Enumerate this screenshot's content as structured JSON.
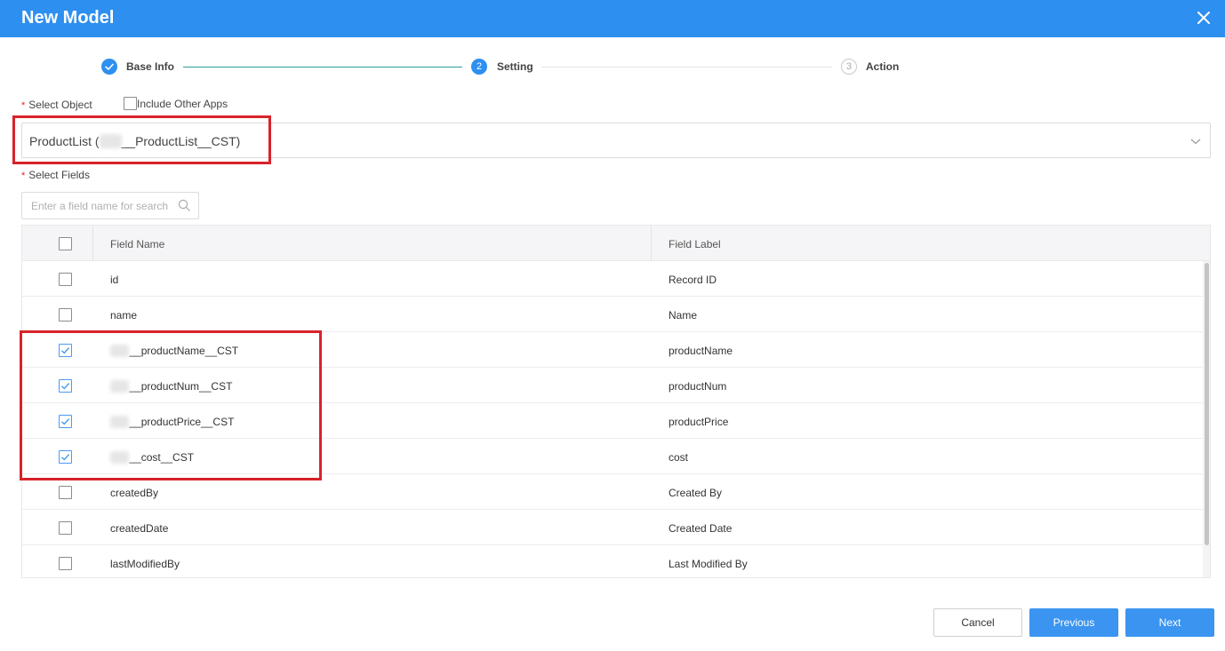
{
  "dialog": {
    "title": "New Model",
    "close_icon": "close-icon"
  },
  "steps": [
    {
      "label": "Base Info",
      "state": "done",
      "number": "1"
    },
    {
      "label": "Setting",
      "state": "active",
      "number": "2"
    },
    {
      "label": "Action",
      "state": "pending",
      "number": "3"
    }
  ],
  "select_object": {
    "label": "Select Object",
    "include_other_apps_label": "Include Other Apps",
    "include_other_apps_checked": false,
    "value_prefix": "ProductList (",
    "value_blurred": "hws",
    "value_suffix": "__ProductList__CST)"
  },
  "select_fields": {
    "label": "Select Fields",
    "search_placeholder": "Enter a field name for search"
  },
  "table": {
    "columns": {
      "name": "Field Name",
      "label": "Field Label"
    },
    "rows": [
      {
        "prefix": "",
        "name": "id",
        "label": "Record ID",
        "checked": false
      },
      {
        "prefix": "",
        "name": "name",
        "label": "Name",
        "checked": false
      },
      {
        "prefix": "hws",
        "name": "__productName__CST",
        "label": "productName",
        "checked": true
      },
      {
        "prefix": "hws",
        "name": "__productNum__CST",
        "label": "productNum",
        "checked": true
      },
      {
        "prefix": "hws",
        "name": "__productPrice__CST",
        "label": "productPrice",
        "checked": true
      },
      {
        "prefix": "hws",
        "name": "__cost__CST",
        "label": "cost",
        "checked": true
      },
      {
        "prefix": "",
        "name": "createdBy",
        "label": "Created By",
        "checked": false
      },
      {
        "prefix": "",
        "name": "createdDate",
        "label": "Created Date",
        "checked": false
      },
      {
        "prefix": "",
        "name": "lastModifiedBy",
        "label": "Last Modified By",
        "checked": false
      }
    ]
  },
  "footer": {
    "cancel": "Cancel",
    "previous": "Previous",
    "next": "Next"
  },
  "colors": {
    "primary": "#2d8ff0",
    "step_done_line": "#2aa198",
    "annotation": "#d8232a"
  }
}
